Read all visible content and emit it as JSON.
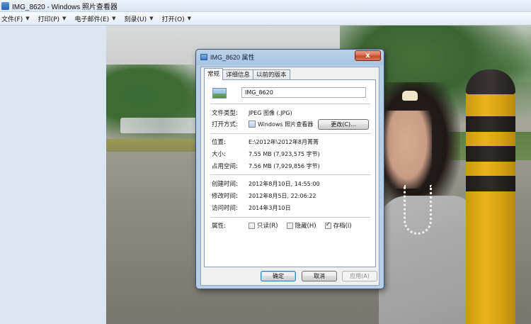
{
  "window": {
    "title": "IMG_8620 - Windows 照片查看器"
  },
  "menubar": {
    "items": [
      {
        "label": "文件(F)"
      },
      {
        "label": "打印(P)"
      },
      {
        "label": "电子邮件(E)"
      },
      {
        "label": "刻录(U)"
      },
      {
        "label": "打开(O)"
      }
    ]
  },
  "dialog": {
    "title": "IMG_8620 属性",
    "close_label": "x",
    "tabs": [
      "常规",
      "详细信息",
      "以前的版本"
    ],
    "file_name": "IMG_8620",
    "file_type": {
      "label": "文件类型:",
      "value": "JPEG 图像 (.JPG)"
    },
    "open_with": {
      "label": "打开方式:",
      "value": "Windows 照片查看器",
      "change_label": "更改(C)..."
    },
    "location": {
      "label": "位置:",
      "value": "E:\\2012年\\2012年8月菁菁"
    },
    "size": {
      "label": "大小:",
      "value": "7.55 MB (7,923,575 字节)"
    },
    "size_on_disk": {
      "label": "占用空间:",
      "value": "7.56 MB (7,929,856 字节)"
    },
    "created": {
      "label": "创建时间:",
      "value": "2012年8月10日, 14:55:00"
    },
    "modified": {
      "label": "修改时间:",
      "value": "2012年8月5日, 22:06:22"
    },
    "accessed": {
      "label": "访问时间:",
      "value": "2014年3月10日"
    },
    "attributes": {
      "label": "属性:",
      "readonly": {
        "label": "只读(R)",
        "checked": false
      },
      "hidden": {
        "label": "隐藏(H)",
        "checked": false
      },
      "archive": {
        "label": "存档(I)",
        "checked": true
      }
    },
    "buttons": {
      "ok": "确定",
      "cancel": "取消",
      "apply": "应用(A)"
    }
  }
}
